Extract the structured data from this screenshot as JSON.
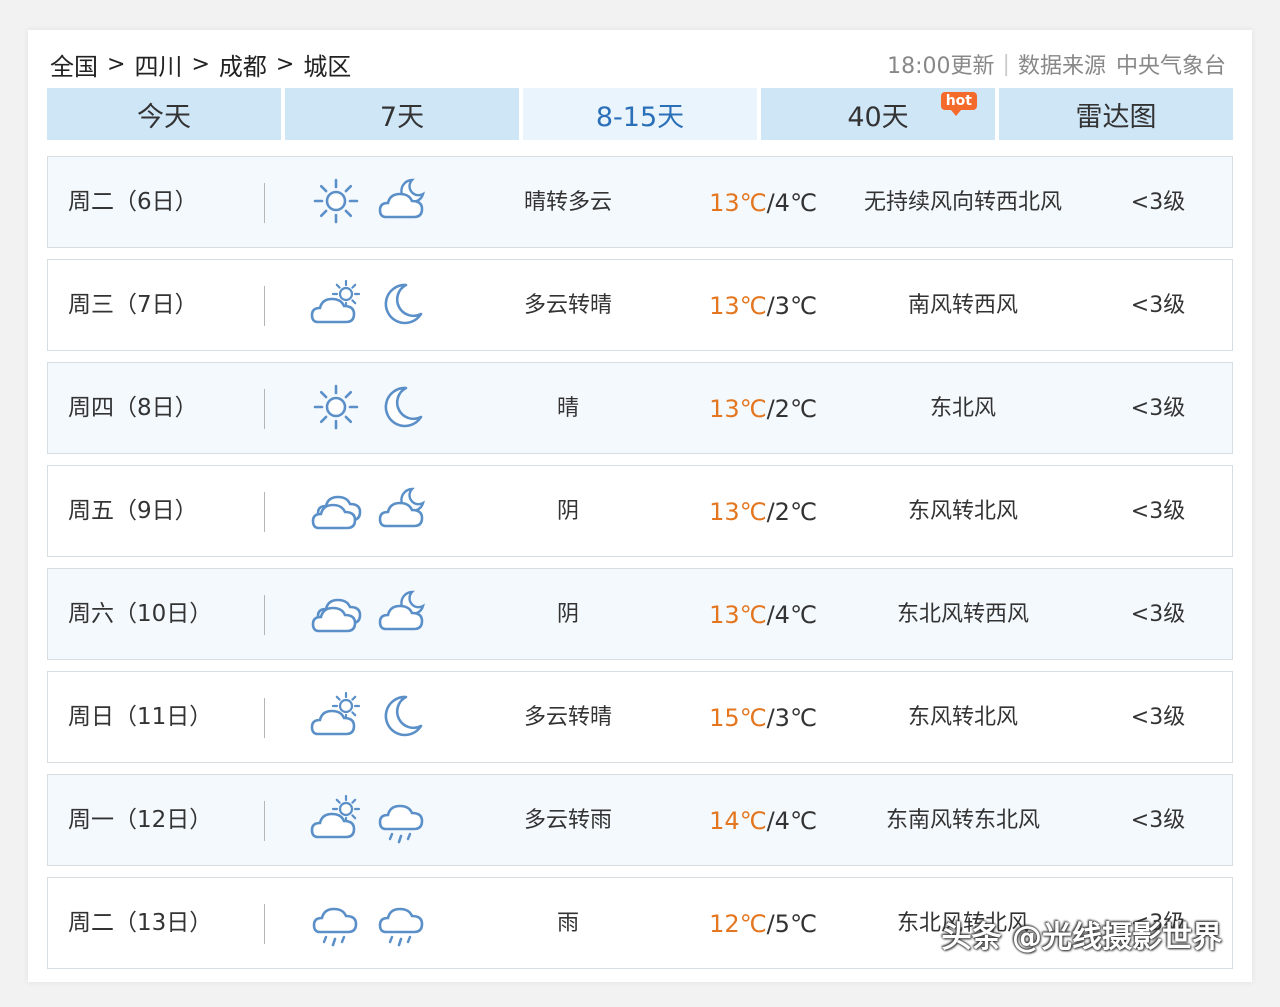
{
  "breadcrumb": {
    "items": [
      "全国",
      "四川",
      "成都",
      "城区"
    ],
    "separator": ">"
  },
  "meta": {
    "update_time": "18:00更新",
    "source_label": "数据来源",
    "source_name": "中央气象台"
  },
  "tabs": [
    {
      "label": "今天"
    },
    {
      "label": "7天"
    },
    {
      "label": "8-15天"
    },
    {
      "label": "40天",
      "badge": "hot"
    },
    {
      "label": "雷达图"
    }
  ],
  "active_tab": "8-15天",
  "colors": {
    "tab_bg": "#cfe6f7",
    "tab_active_text": "#2a6fb8",
    "high_temp": "#e3761f",
    "icon_stroke": "#5a8fc8",
    "hot_badge": "#f36a2b"
  },
  "forecast": [
    {
      "day": "周二（6日）",
      "icon_day": "sun-icon",
      "icon_night": "cloud-moon-icon",
      "desc": "晴转多云",
      "high": "13℃",
      "low": "4℃",
      "wind": "无持续风向转西北风",
      "level": "<3级"
    },
    {
      "day": "周三（7日）",
      "icon_day": "partly-cloudy-icon",
      "icon_night": "moon-icon",
      "desc": "多云转晴",
      "high": "13℃",
      "low": "3℃",
      "wind": "南风转西风",
      "level": "<3级"
    },
    {
      "day": "周四（8日）",
      "icon_day": "sun-icon",
      "icon_night": "moon-icon",
      "desc": "晴",
      "high": "13℃",
      "low": "2℃",
      "wind": "东北风",
      "level": "<3级"
    },
    {
      "day": "周五（9日）",
      "icon_day": "overcast-icon",
      "icon_night": "cloud-moon-icon",
      "desc": "阴",
      "high": "13℃",
      "low": "2℃",
      "wind": "东风转北风",
      "level": "<3级"
    },
    {
      "day": "周六（10日）",
      "icon_day": "overcast-icon",
      "icon_night": "cloud-moon-icon",
      "desc": "阴",
      "high": "13℃",
      "low": "4℃",
      "wind": "东北风转西风",
      "level": "<3级"
    },
    {
      "day": "周日（11日）",
      "icon_day": "partly-cloudy-icon",
      "icon_night": "moon-icon",
      "desc": "多云转晴",
      "high": "15℃",
      "low": "3℃",
      "wind": "东风转北风",
      "level": "<3级"
    },
    {
      "day": "周一（12日）",
      "icon_day": "partly-cloudy-icon",
      "icon_night": "rain-icon",
      "desc": "多云转雨",
      "high": "14℃",
      "low": "4℃",
      "wind": "东南风转东北风",
      "level": "<3级"
    },
    {
      "day": "周二（13日）",
      "icon_day": "rain-icon",
      "icon_night": "rain-icon",
      "desc": "雨",
      "high": "12℃",
      "low": "5℃",
      "wind": "东北风转北风",
      "level": "<3级"
    }
  ],
  "watermark": "头条 @光线摄影世界"
}
